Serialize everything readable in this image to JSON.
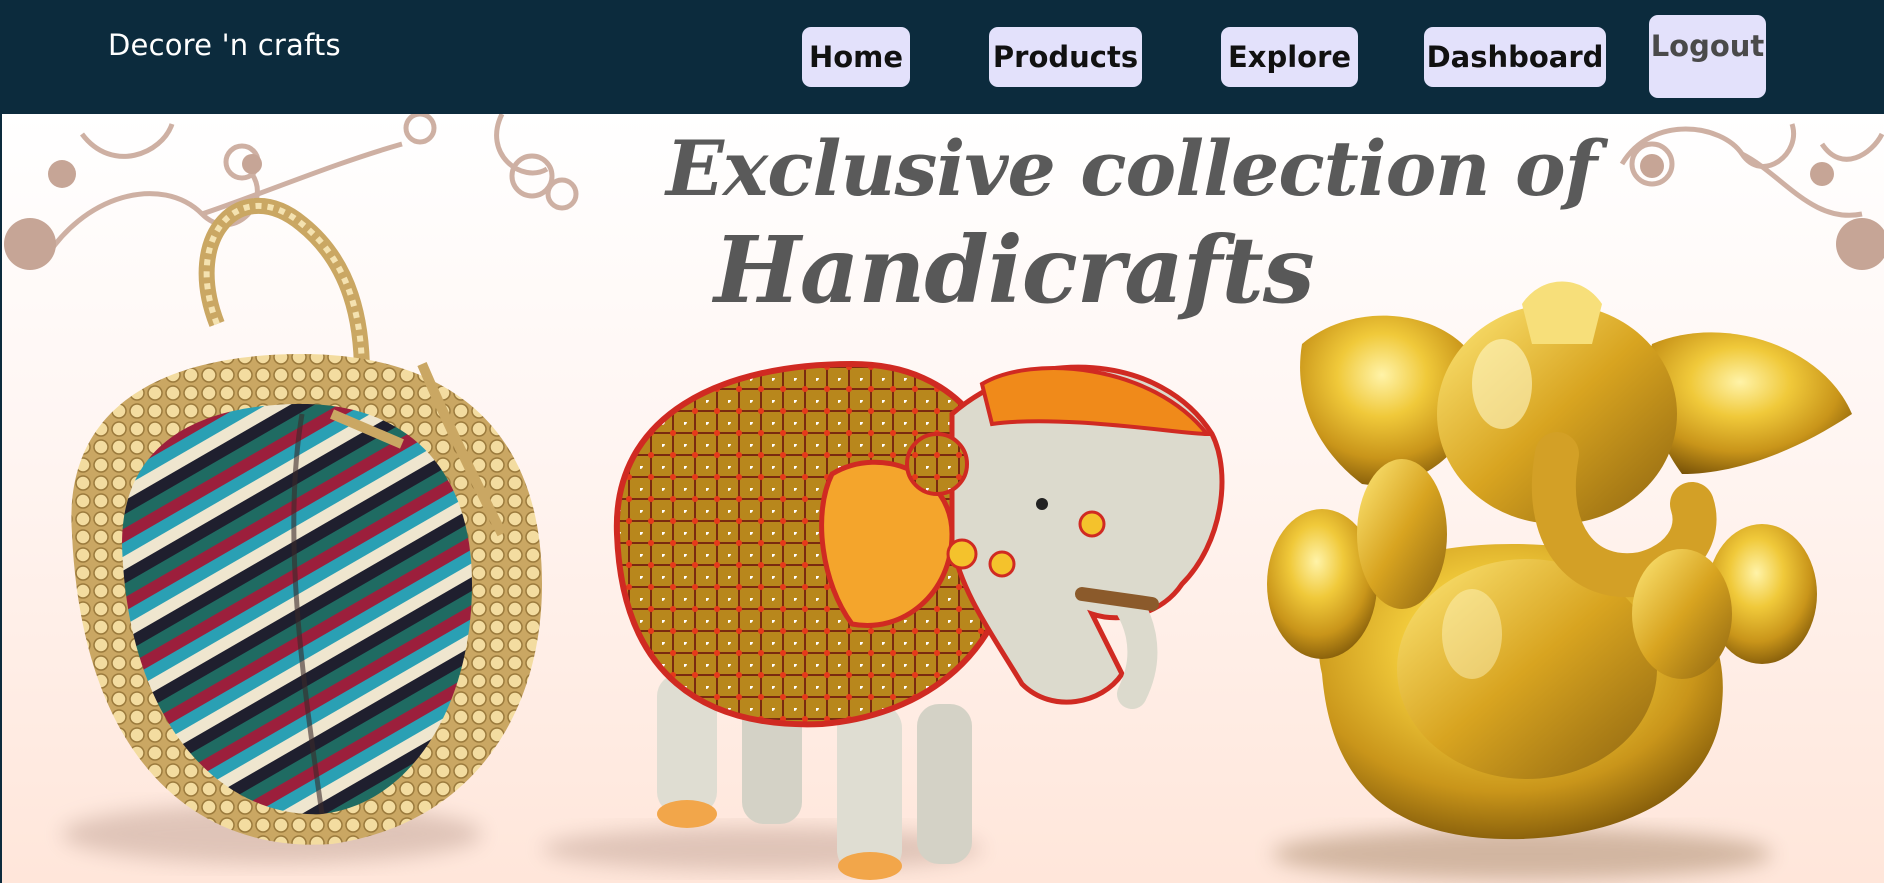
{
  "brand": {
    "name": "Decore 'n crafts"
  },
  "nav": {
    "home": "Home",
    "products": "Products",
    "explore": "Explore",
    "dashboard": "Dashboard",
    "logout": "Logout"
  },
  "hero": {
    "headline_line1": "Exclusive collection of",
    "headline_line2": "Handicrafts",
    "items": [
      "potli-bag-image",
      "painted-elephant-figurine-image",
      "golden-ganesha-idol-image"
    ]
  },
  "colors": {
    "navbar_bg": "#0c2b3d",
    "button_bg": "#e3e1fb",
    "headline_text": "#585858"
  }
}
